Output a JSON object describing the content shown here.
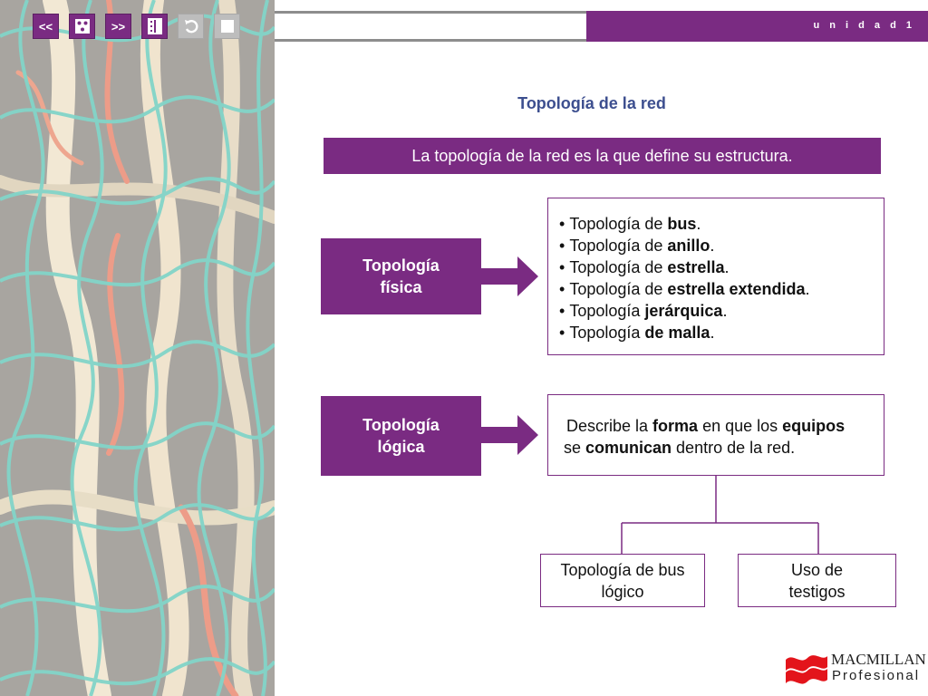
{
  "toolbar": {
    "prev_label": "<<",
    "next_label": ">>",
    "icons": [
      "menu-dots-icon",
      "index-icon",
      "undo-icon",
      "stop-icon"
    ]
  },
  "header": {
    "unit_label": "u n i d a d  1"
  },
  "main": {
    "title": "Topología de la red",
    "definition": "La topología de la red es la que define su estructura.",
    "physical": {
      "label_line1": "Topología",
      "label_line2": "física",
      "items": [
        {
          "prefix": "Topología de ",
          "bold": "bus",
          "suffix": "."
        },
        {
          "prefix": "Topología de ",
          "bold": "anillo",
          "suffix": "."
        },
        {
          "prefix": "Topología de ",
          "bold": "estrella",
          "suffix": "."
        },
        {
          "prefix": "Topología de ",
          "bold": "estrella extendida",
          "suffix": "."
        },
        {
          "prefix": "Topología ",
          "bold": "jerárquica",
          "suffix": "."
        },
        {
          "prefix": "Topología ",
          "bold": "de malla",
          "suffix": "."
        }
      ]
    },
    "logical": {
      "label_line1": "Topología",
      "label_line2": "lógica",
      "desc": {
        "t1": "Describe la ",
        "b1": "forma",
        "t2": " en que los ",
        "b2": "equipos",
        "t3": "se ",
        "b3": "comunican",
        "t4": " dentro de la red."
      },
      "children": [
        {
          "line1": "Topología de bus",
          "line2": "lógico"
        },
        {
          "line1": "Uso de",
          "line2": "testigos"
        }
      ]
    }
  },
  "logo": {
    "line1": "MACMILLAN",
    "line2": "Profesional"
  },
  "colors": {
    "accent": "#7a2b82",
    "title": "#3d4f8f",
    "rule": "#8d8d8d"
  }
}
